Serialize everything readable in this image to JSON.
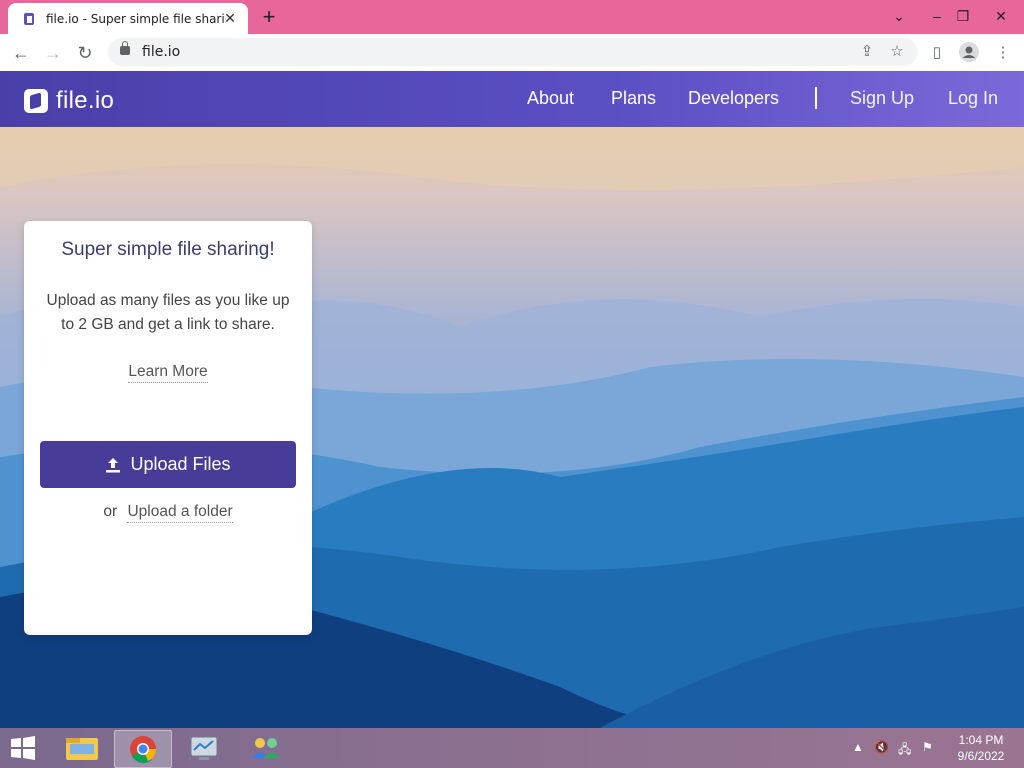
{
  "browser": {
    "tab_title": "file.io - Super simple file sharing",
    "url": "file.io"
  },
  "site": {
    "logo_text": "file.io",
    "nav": {
      "about": "About",
      "plans": "Plans",
      "developers": "Developers",
      "sign_up": "Sign Up",
      "log_in": "Log In"
    }
  },
  "card": {
    "title": "Super simple file sharing!",
    "description": "Upload as many files as you like up to 2 GB and get a link to share.",
    "learn_more": "Learn More",
    "upload_button": "Upload Files",
    "or_text": "or",
    "upload_folder": "Upload a folder"
  },
  "taskbar": {
    "time": "1:04 PM",
    "date": "9/6/2022"
  },
  "colors": {
    "tabstrip": "#e8679a",
    "header": "#4a3fa8",
    "button": "#473d98"
  }
}
